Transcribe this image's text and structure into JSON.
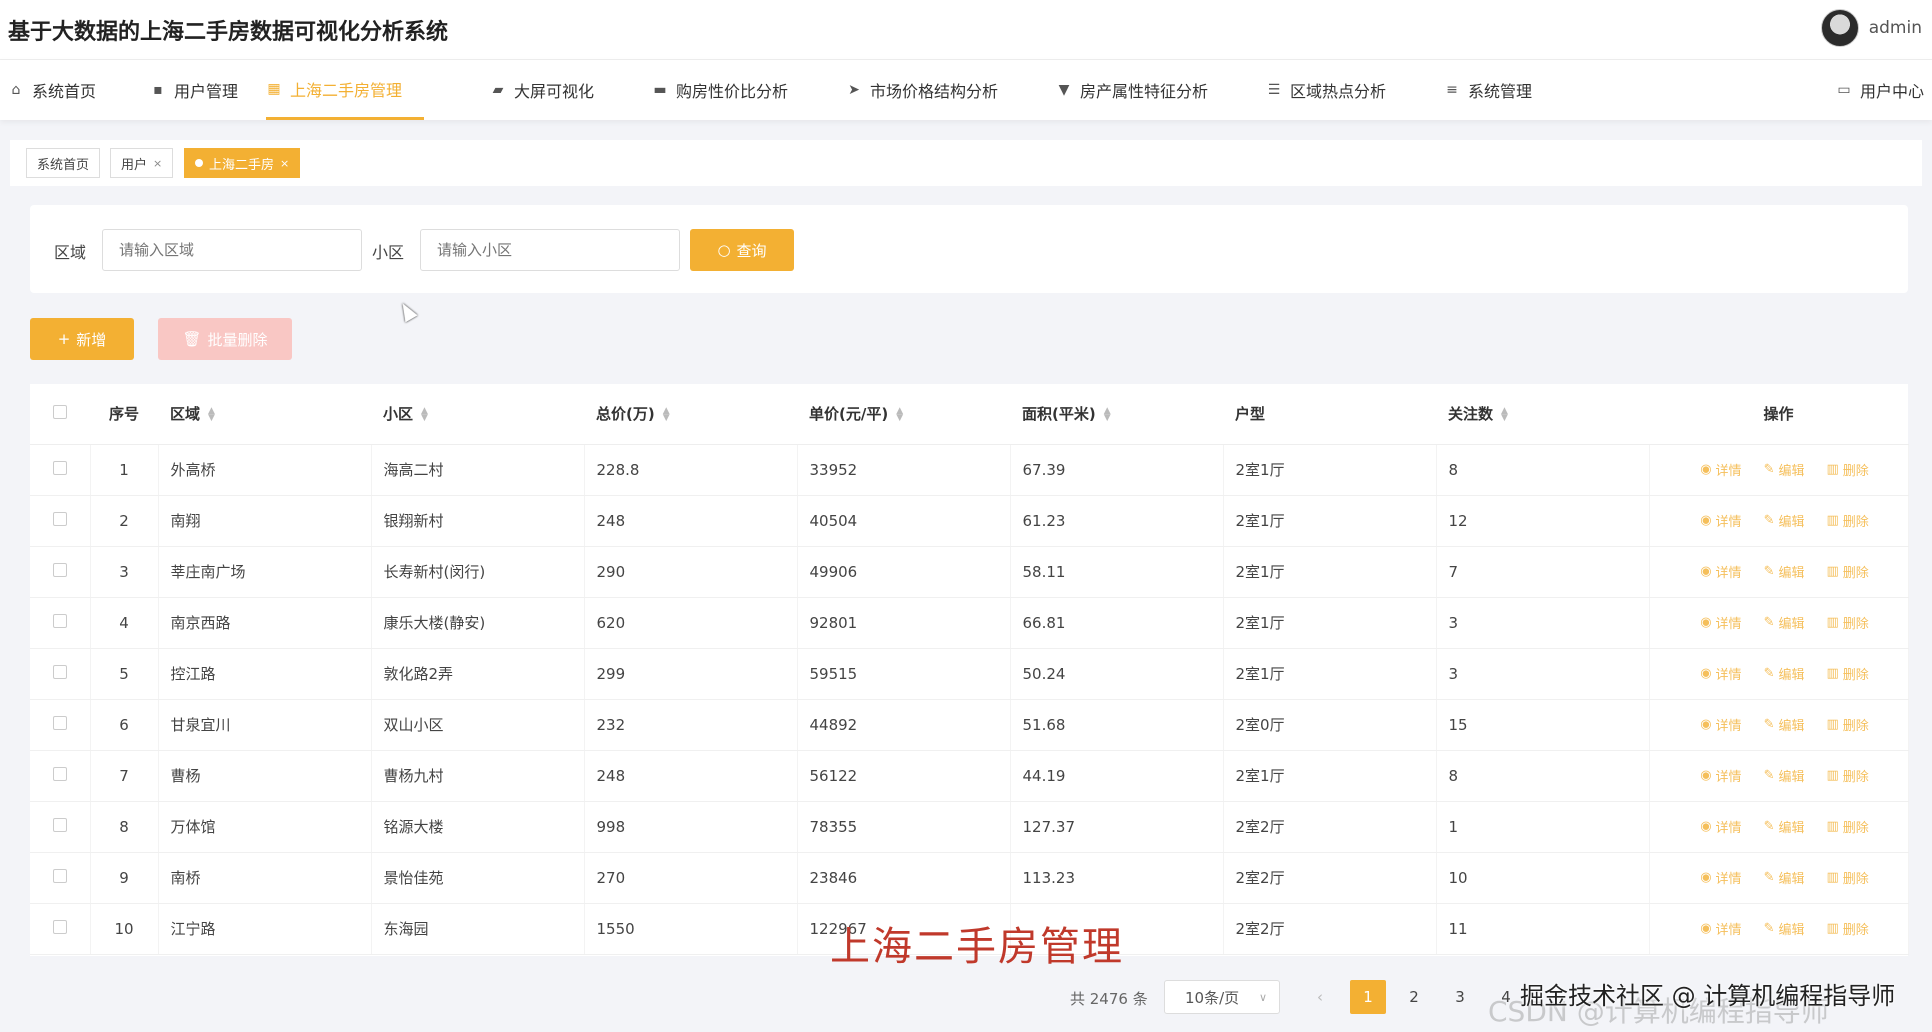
{
  "app": {
    "title": "基于大数据的上海二手房数据可视化分析系统",
    "username": "admin"
  },
  "nav": {
    "items": [
      {
        "label": "系统首页",
        "icon": "home-icon"
      },
      {
        "label": "用户管理",
        "icon": "chat-icon"
      },
      {
        "label": "上海二手房管理",
        "icon": "grid-icon"
      },
      {
        "label": "大屏可视化",
        "icon": "briefcase-icon"
      },
      {
        "label": "购房性价比分析",
        "icon": "toolbox-icon"
      },
      {
        "label": "市场价格结构分析",
        "icon": "send-icon"
      },
      {
        "label": "房产属性特征分析",
        "icon": "pin-icon"
      },
      {
        "label": "区域热点分析",
        "icon": "sliders-icon"
      },
      {
        "label": "系统管理",
        "icon": "list-icon"
      }
    ],
    "user_center": "用户中心",
    "active_index": 2
  },
  "tags": [
    "系统首页",
    "用户",
    "上海二手房"
  ],
  "search": {
    "region_label": "区域",
    "region_placeholder": "请输入区域",
    "community_label": "小区",
    "community_placeholder": "请输入小区",
    "query_label": "查询"
  },
  "actions": {
    "add_label": "新增",
    "batch_delete_label": "批量删除"
  },
  "table": {
    "columns": [
      "序号",
      "区域",
      "小区",
      "总价(万)",
      "单价(元/平)",
      "面积(平米)",
      "户型",
      "关注数",
      "操作"
    ],
    "op_labels": [
      "详情",
      "编辑",
      "删除"
    ],
    "rows": [
      [
        "1",
        "外高桥",
        "海高二村",
        "228.8",
        "33952",
        "67.39",
        "2室1厅",
        "8"
      ],
      [
        "2",
        "南翔",
        "银翔新村",
        "248",
        "40504",
        "61.23",
        "2室1厅",
        "12"
      ],
      [
        "3",
        "莘庄南广场",
        "长寿新村(闵行)",
        "290",
        "49906",
        "58.11",
        "2室1厅",
        "7"
      ],
      [
        "4",
        "南京西路",
        "康乐大楼(静安)",
        "620",
        "92801",
        "66.81",
        "2室1厅",
        "3"
      ],
      [
        "5",
        "控江路",
        "敦化路2弄",
        "299",
        "59515",
        "50.24",
        "2室1厅",
        "3"
      ],
      [
        "6",
        "甘泉宜川",
        "双山小区",
        "232",
        "44892",
        "51.68",
        "2室0厅",
        "15"
      ],
      [
        "7",
        "曹杨",
        "曹杨九村",
        "248",
        "56122",
        "44.19",
        "2室1厅",
        "8"
      ],
      [
        "8",
        "万体馆",
        "铭源大楼",
        "998",
        "78355",
        "127.37",
        "2室2厅",
        "1"
      ],
      [
        "9",
        "南桥",
        "景怡佳苑",
        "270",
        "23846",
        "113.23",
        "2室2厅",
        "10"
      ],
      [
        "10",
        "江宁路",
        "东海园",
        "1550",
        "122967",
        "",
        "2室2厅",
        "11"
      ]
    ]
  },
  "pagination": {
    "total_text": "共 2476 条",
    "page_size": "10条/页",
    "pages": [
      "1",
      "2",
      "3",
      "4"
    ],
    "current": "1"
  },
  "overlay": {
    "caption": "上海二手房管理",
    "watermark": "掘金技术社区 @ 计算机编程指导师",
    "watermark_bg": "CSDN @计算机编程指导师"
  },
  "colors": {
    "accent": "#f3b033",
    "danger_light": "#f9c7c4",
    "caption": "#c0392b"
  }
}
